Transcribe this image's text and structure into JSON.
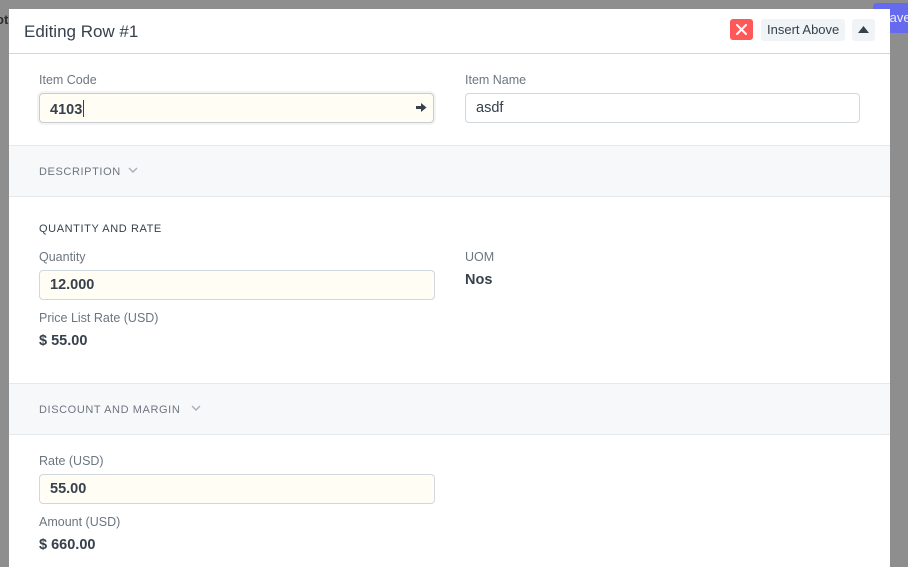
{
  "background": {
    "left_text": "ot",
    "save_label": "Save"
  },
  "modal": {
    "title": "Editing Row #1",
    "insert_above_label": "Insert Above"
  },
  "item": {
    "item_code_label": "Item Code",
    "item_code_value": "4103",
    "item_name_label": "Item Name",
    "item_name_value": "asdf"
  },
  "description_section": {
    "title": "DESCRIPTION"
  },
  "quantity_section": {
    "title": "QUANTITY AND RATE",
    "quantity_label": "Quantity",
    "quantity_value": "12.000",
    "uom_label": "UOM",
    "uom_value": "Nos",
    "price_list_rate_label": "Price List Rate (USD)",
    "price_list_rate_value": "$ 55.00"
  },
  "discount_section": {
    "title": "DISCOUNT AND MARGIN"
  },
  "rate_section": {
    "rate_label": "Rate (USD)",
    "rate_value": "55.00",
    "amount_label": "Amount (USD)",
    "amount_value": "$ 660.00"
  },
  "colors": {
    "close_button": "#ff5858",
    "save_button": "#5e64ff",
    "field_highlight": "#fffdf4"
  },
  "icons": {
    "close": "close-icon",
    "collapse": "caret-up-icon",
    "link_arrow": "arrow-right-icon",
    "section_toggle": "chevron-down-icon"
  }
}
